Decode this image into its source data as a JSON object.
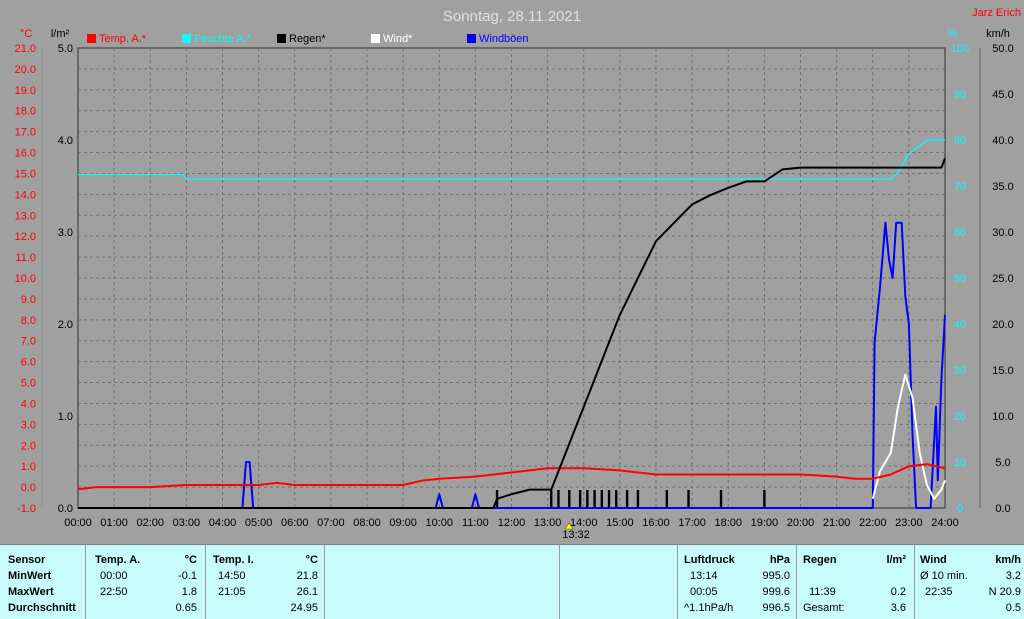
{
  "title": "Sonntag, 28.11.2021",
  "author": "Jarz Erich",
  "legend": [
    {
      "label": "Temp. A.*",
      "color": "#ff0000"
    },
    {
      "label": "Feuchte A.*",
      "color": "#00ffff"
    },
    {
      "label": "Regen*",
      "color": "#000000"
    },
    {
      "label": "Wind*",
      "color": "#ffffff"
    },
    {
      "label": "Windböen",
      "color": "#0000ff"
    }
  ],
  "axis_units": {
    "temp": "°C",
    "rain": "l/m²",
    "hum": "%",
    "wind": "km/h"
  },
  "marker_label": "13:32",
  "chart_data": {
    "type": "line",
    "x_ticks": [
      "00:00",
      "01:00",
      "02:00",
      "03:00",
      "04:00",
      "05:00",
      "06:00",
      "07:00",
      "08:00",
      "09:00",
      "10:00",
      "11:00",
      "12:00",
      "13:00",
      "14:00",
      "15:00",
      "16:00",
      "17:00",
      "18:00",
      "19:00",
      "20:00",
      "21:00",
      "22:00",
      "23:00",
      "24:00"
    ],
    "xlim": [
      0,
      24
    ],
    "y_axes": {
      "temp": {
        "label": "°C",
        "range": [
          -1.0,
          21.0
        ],
        "ticks": [
          "21.0",
          "20.0",
          "19.0",
          "18.0",
          "17.0",
          "16.0",
          "15.0",
          "14.0",
          "13.0",
          "12.0",
          "11.0",
          "10.0",
          "9.0",
          "8.0",
          "7.0",
          "6.0",
          "5.0",
          "4.0",
          "3.0",
          "2.0",
          "1.0",
          "0.0",
          "-1.0"
        ]
      },
      "rain": {
        "label": "l/m²",
        "range": [
          0,
          5.0
        ],
        "ticks": [
          "5.0",
          "4.0",
          "3.0",
          "2.0",
          "1.0",
          "0.0"
        ]
      },
      "hum": {
        "label": "%",
        "range": [
          0,
          100
        ],
        "ticks": [
          "100",
          "90",
          "80",
          "70",
          "60",
          "50",
          "40",
          "30",
          "20",
          "10",
          "0"
        ]
      },
      "wind": {
        "label": "km/h",
        "range": [
          0,
          50.0
        ],
        "ticks": [
          "50.0",
          "45.0",
          "40.0",
          "35.0",
          "30.0",
          "25.0",
          "20.0",
          "15.0",
          "10.0",
          "5.0",
          "0.0"
        ]
      }
    },
    "grid": true,
    "series": [
      {
        "name": "Temp. A.*",
        "axis": "temp",
        "color": "#ff0000",
        "x": [
          0,
          0.5,
          1,
          2,
          3,
          4,
          5,
          5.5,
          6,
          7,
          8,
          9,
          9.5,
          10,
          11,
          12,
          13,
          14,
          15,
          16,
          17,
          18,
          19,
          20,
          21,
          21.5,
          22,
          22.5,
          23,
          23.5,
          24
        ],
        "y": [
          -0.1,
          0.0,
          0.0,
          0.0,
          0.1,
          0.1,
          0.1,
          0.2,
          0.1,
          0.1,
          0.1,
          0.1,
          0.3,
          0.4,
          0.5,
          0.7,
          0.9,
          0.9,
          0.8,
          0.6,
          0.6,
          0.6,
          0.6,
          0.6,
          0.5,
          0.4,
          0.4,
          0.6,
          1.0,
          1.1,
          0.9
        ]
      },
      {
        "name": "Feuchte A.*",
        "axis": "hum",
        "color": "#00ffff",
        "x": [
          0,
          2.9,
          3.0,
          22.5,
          22.7,
          23.0,
          23.5,
          24
        ],
        "y": [
          72.5,
          72.5,
          71.5,
          71.5,
          73,
          77,
          80,
          80
        ]
      },
      {
        "name": "Regen*",
        "axis": "rain",
        "color": "#000000",
        "x": [
          0,
          11.5,
          11.6,
          12.0,
          12.5,
          13.1,
          13.3,
          13.6,
          14.0,
          14.5,
          15.0,
          15.5,
          16.0,
          16.5,
          17.0,
          17.5,
          18.0,
          18.5,
          19.0,
          19.5,
          20.0,
          21,
          22,
          23,
          23.9,
          24
        ],
        "y": [
          0,
          0,
          0.1,
          0.15,
          0.2,
          0.2,
          0.4,
          0.7,
          1.1,
          1.6,
          2.1,
          2.5,
          2.9,
          3.1,
          3.3,
          3.4,
          3.48,
          3.55,
          3.55,
          3.68,
          3.7,
          3.7,
          3.7,
          3.7,
          3.7,
          3.8
        ]
      },
      {
        "name": "Wind*",
        "axis": "wind",
        "color": "#ffffff",
        "x": [
          22.0,
          22.2,
          22.5,
          22.7,
          22.9,
          23.1,
          23.3,
          23.5,
          23.7,
          23.9,
          24
        ],
        "y": [
          1.0,
          4.0,
          6.0,
          11.0,
          14.5,
          12.0,
          6.0,
          2.5,
          1.0,
          2.0,
          3.0
        ]
      },
      {
        "name": "Windböen",
        "axis": "wind",
        "color": "#0000ff",
        "x": [
          0,
          4.55,
          4.65,
          4.75,
          4.85,
          9.9,
          10.0,
          10.1,
          10.9,
          11.0,
          11.1,
          22.0,
          22.05,
          22.2,
          22.35,
          22.45,
          22.55,
          22.65,
          22.8,
          22.9,
          23.0,
          23.1,
          23.2,
          23.3,
          23.4,
          23.6,
          23.75,
          23.8,
          23.9,
          24.0
        ],
        "y": [
          0,
          0,
          5,
          5,
          0,
          0,
          1.5,
          0,
          0,
          1.5,
          0,
          0,
          18,
          24,
          31,
          27,
          25,
          31,
          31,
          23,
          20,
          8,
          0,
          0,
          0,
          0,
          11,
          3,
          14,
          21
        ]
      }
    ]
  },
  "rain_ticks_hours": [
    11.6,
    13.1,
    13.3,
    13.6,
    13.9,
    14.1,
    14.3,
    14.5,
    14.7,
    14.9,
    15.2,
    15.5,
    16.3,
    16.9,
    17.8,
    19.0
  ],
  "table": {
    "headers": {
      "sensor": "Sensor",
      "temp_a": "Temp. A.",
      "temp_i": "Temp. I.",
      "pressure": "Luftdruck",
      "rain": "Regen",
      "wind": "Wind"
    },
    "units": {
      "temp_a": "°C",
      "temp_i": "°C",
      "pressure": "hPa",
      "rain": "l/m²",
      "wind": "km/h"
    },
    "rows": {
      "min": "MinWert",
      "max": "MaxWert",
      "avg": "Durchschnitt"
    },
    "temp_a": {
      "min_time": "00:00",
      "min_val": "-0.1",
      "max_time": "22:50",
      "max_val": "1.8",
      "avg": "0.65"
    },
    "temp_i": {
      "min_time": "14:50",
      "min_val": "21.8",
      "max_time": "21:05",
      "max_val": "26.1",
      "avg": "24.95"
    },
    "pressure": {
      "min_time": "13:14",
      "min_val": "995.0",
      "max_time": "00:05",
      "max_val": "999.6",
      "trend_label": "^1.1hPa/h",
      "avg": "996.5"
    },
    "rain": {
      "max_time": "11:39",
      "max_val": "0.2",
      "total_label": "Gesamt:",
      "total": "3.6"
    },
    "wind": {
      "min_label": "Ø 10 min.",
      "min_val": "3.2",
      "max_time": "22:35",
      "max_val": "N 20.9",
      "avg": "0.5"
    }
  }
}
